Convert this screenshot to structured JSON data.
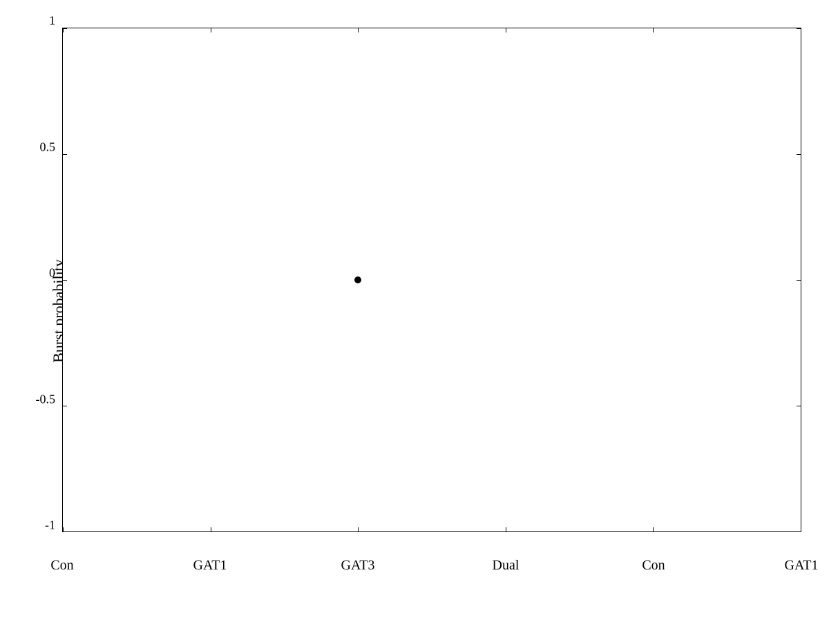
{
  "chart": {
    "title": "",
    "y_axis_label": "Burst probability",
    "x_labels": [
      "Con",
      "GAT1",
      "GAT3",
      "Dual",
      "Con",
      "GAT1"
    ],
    "y_ticks": [
      1,
      0.5,
      0,
      -0.5,
      -1
    ],
    "y_min": -1,
    "y_max": 1,
    "data_points": [
      {
        "x_index": 2,
        "y_value": 0.0,
        "label": "GAT3 data point"
      }
    ]
  }
}
